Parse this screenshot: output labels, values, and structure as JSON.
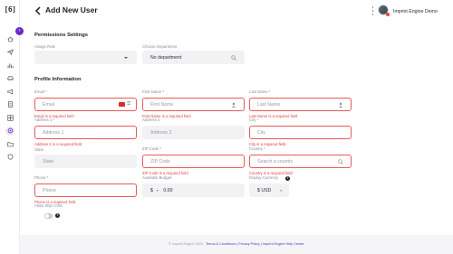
{
  "app": {
    "logo_text": "[6]"
  },
  "header": {
    "title": "Add New User",
    "user_name": "Imprint Engine Demo"
  },
  "sidebar": {
    "items": [
      {
        "icon": "home-icon"
      },
      {
        "icon": "send-icon"
      },
      {
        "icon": "chart-icon"
      },
      {
        "icon": "car-icon"
      },
      {
        "icon": "megaphone-icon"
      },
      {
        "icon": "document-icon"
      },
      {
        "icon": "grid-icon"
      },
      {
        "icon": "user-settings-icon",
        "active": true
      },
      {
        "icon": "folder-icon"
      },
      {
        "icon": "shield-icon"
      }
    ]
  },
  "permissions": {
    "title": "Permissions Settings",
    "assign_role_label": "Assign Role",
    "assign_role_value": "",
    "department_label": "Choose Department",
    "department_value": "No department"
  },
  "profile": {
    "title": "Profile Information",
    "email": {
      "label": "Email *",
      "placeholder": "Email",
      "error": "Email is a required field"
    },
    "first_name": {
      "label": "First Name *",
      "placeholder": "First Name",
      "error": "First Name is a required field"
    },
    "last_name": {
      "label": "Last Name *",
      "placeholder": "Last Name",
      "error": "Last Name is a required field"
    },
    "address1": {
      "label": "Address 1 *",
      "placeholder": "Address 1",
      "error": "Address 1 is a required field"
    },
    "address2": {
      "label": "Address 2",
      "placeholder": "Address 2"
    },
    "city": {
      "label": "City *",
      "placeholder": "City",
      "error": "City is a required field"
    },
    "state": {
      "label": "State",
      "placeholder": "State"
    },
    "zip": {
      "label": "ZIP Code *",
      "placeholder": "ZIP Code",
      "error": "ZIP Code is a required field"
    },
    "country": {
      "label": "Country *",
      "placeholder": "Search a country",
      "error": "Country is a required field"
    },
    "phone": {
      "label": "Phone *",
      "placeholder": "Phone",
      "error": "Phone is a required field"
    },
    "budget": {
      "label": "Available Budget",
      "currency": "$",
      "value": "0.00"
    },
    "currency": {
      "label": "Deploy Currency",
      "value": "$ USD"
    },
    "skip_cvm": {
      "label": "Allow Skip CVM"
    }
  },
  "footer": {
    "copyright": "© Imprint Engine 2023 · ",
    "links": "Terms & Conditions | Privacy Policy | Imprint Engine Help Center"
  },
  "colors": {
    "accent": "#6a2bc4",
    "error": "#e23d3d"
  }
}
